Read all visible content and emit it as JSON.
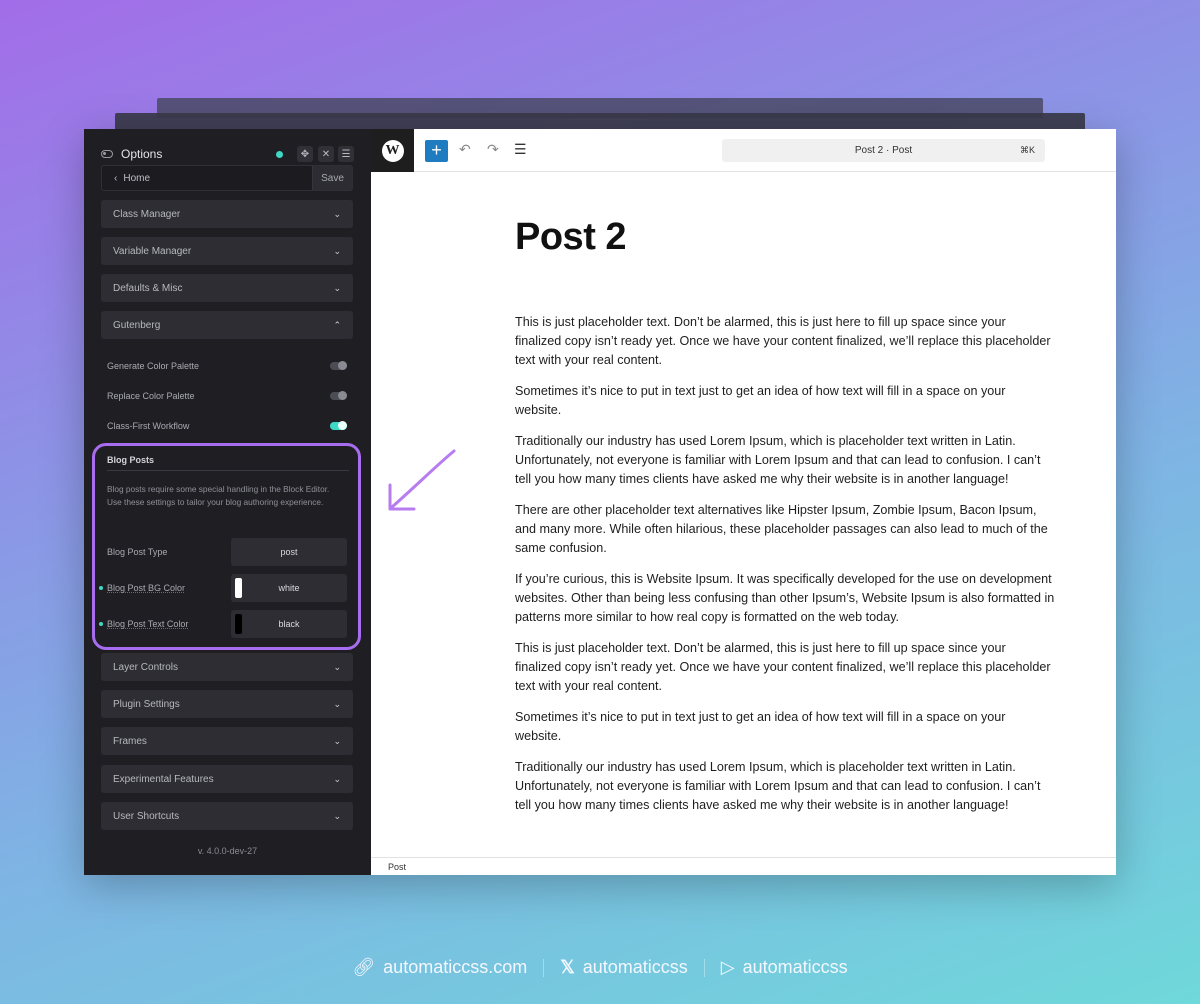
{
  "sidebar": {
    "title": "Options",
    "home_label": "Home",
    "save_label": "Save",
    "accordions_top": [
      {
        "label": "Class Manager",
        "expanded": false
      },
      {
        "label": "Variable Manager",
        "expanded": false
      },
      {
        "label": "Defaults & Misc",
        "expanded": false
      },
      {
        "label": "Gutenberg",
        "expanded": true
      }
    ],
    "toggles": [
      {
        "label": "Generate Color Palette",
        "on": false
      },
      {
        "label": "Replace Color Palette",
        "on": false
      },
      {
        "label": "Class-First Workflow",
        "on": true
      }
    ],
    "blog_posts": {
      "title": "Blog Posts",
      "description": "Blog posts require some special handling in the Block Editor. Use these settings to tailor your blog authoring experience.",
      "fields": [
        {
          "label": "Blog Post Type",
          "value": "post"
        },
        {
          "label": "Blog Post BG Color",
          "value": "white",
          "swatch": "#ffffff"
        },
        {
          "label": "Blog Post Text Color",
          "value": "black",
          "swatch": "#000000"
        }
      ]
    },
    "accordions_bottom": [
      {
        "label": "Layer Controls"
      },
      {
        "label": "Plugin Settings"
      },
      {
        "label": "Frames"
      },
      {
        "label": "Experimental Features"
      },
      {
        "label": "User Shortcuts"
      }
    ],
    "version": "v. 4.0.0-dev-27"
  },
  "editor": {
    "command_bar": "Post 2 · Post",
    "shortcut": "⌘K",
    "post_title": "Post 2",
    "paragraphs": [
      "This is just placeholder text. Don’t be alarmed, this is just here to fill up space since your finalized copy isn’t ready yet. Once we have your content finalized, we’ll replace this placeholder text with your real content.",
      "Sometimes it’s nice to put in text just to get an idea of how text will fill in a space on your website.",
      "Traditionally our industry has used Lorem Ipsum, which is placeholder text written in Latin. Unfortunately, not everyone is familiar with Lorem Ipsum and that can lead to confusion. I can’t tell you how many times clients have asked me why their website is in another language!",
      "There are other placeholder text alternatives like Hipster Ipsum, Zombie Ipsum, Bacon Ipsum, and many more. While often hilarious, these placeholder passages can also lead to much of the same confusion.",
      "If you’re curious, this is Website Ipsum. It was specifically developed for the use on development websites. Other than being less confusing than other Ipsum’s, Website Ipsum is also formatted in patterns more similar to how real copy is formatted on the web today.",
      "This is just placeholder text. Don’t be alarmed, this is just here to fill up space since your finalized copy isn’t ready yet. Once we have your content finalized, we’ll replace this placeholder text with your real content.",
      "Sometimes it’s nice to put in text just to get an idea of how text will fill in a space on your website.",
      "Traditionally our industry has used Lorem Ipsum, which is placeholder text written in Latin. Unfortunately, not everyone is familiar with Lorem Ipsum and that can lead to confusion. I can’t tell you how many times clients have asked me why their website is in another language!"
    ],
    "status_label": "Post"
  },
  "footer": {
    "website": "automaticcss.com",
    "x_handle": "automaticcss",
    "youtube_handle": "automaticcss"
  },
  "colors": {
    "accent_teal": "#3fd8c6",
    "highlight_purple": "#a86cf0",
    "wp_blue": "#1f7cc1"
  }
}
